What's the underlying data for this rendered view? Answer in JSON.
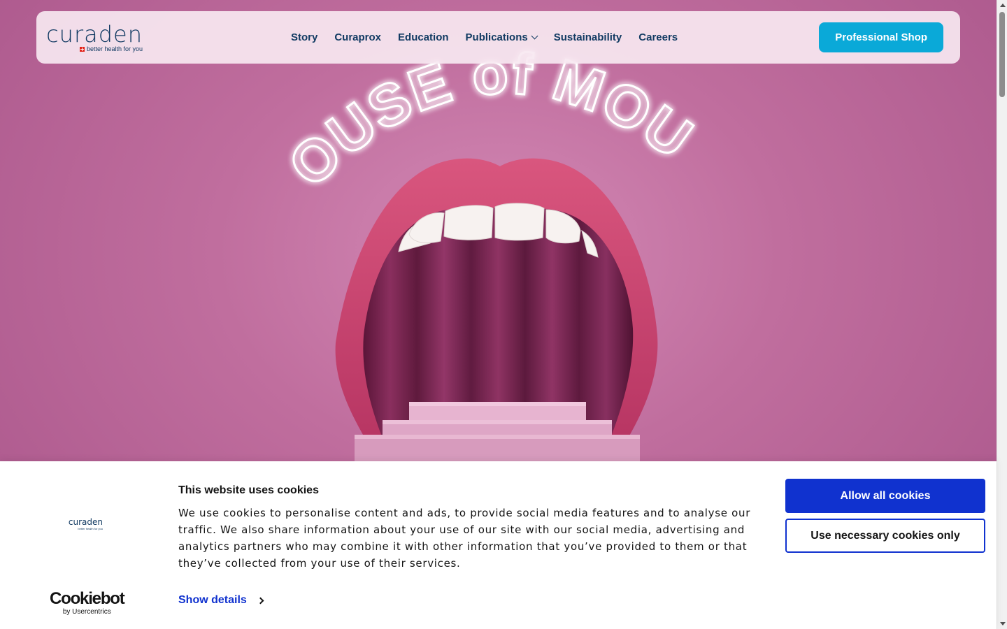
{
  "header": {
    "logo_word": "curaden",
    "logo_tagline": "better health for you",
    "nav": [
      {
        "label": "Story"
      },
      {
        "label": "Curaprox"
      },
      {
        "label": "Education"
      },
      {
        "label": "Publications"
      },
      {
        "label": "Sustainability"
      },
      {
        "label": "Careers"
      }
    ],
    "shop_button": "Professional Shop"
  },
  "hero": {
    "neon_sign": "HOUSE of MOUTH"
  },
  "cookie_banner": {
    "logo_word": "curaden",
    "logo_tagline": "better health for you",
    "title": "This website uses cookies",
    "body": "We use cookies to personalise content and ads, to provide social media features and to analyse our traffic. We also share information about your use of our site with our social media, advertising and analytics partners who may combine it with other information that you’ve provided to them or that they’ve collected from your use of their services.",
    "show_details": "Show details",
    "allow_all": "Allow all cookies",
    "necessary_only": "Use necessary cookies only",
    "cookiebot_word": "Cookiebot",
    "cookiebot_sub": "by Usercentrics"
  },
  "colors": {
    "brand_navy": "#123b63",
    "shop_cyan": "#0aa9d8",
    "cookie_blue": "#1032cf",
    "hero_pink": "#c06e9e"
  }
}
